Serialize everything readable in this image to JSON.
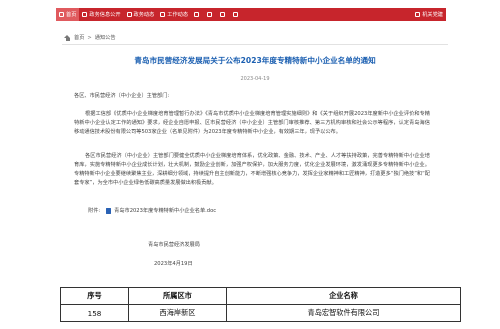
{
  "nav": {
    "items": [
      {
        "label": "首页",
        "icon": "home-icon",
        "active": true
      },
      {
        "label": "政务信息公开",
        "icon": "document-icon"
      },
      {
        "label": "政务动态",
        "icon": "news-icon"
      },
      {
        "label": "工作动态",
        "icon": "briefcase-icon"
      },
      {
        "label": "",
        "icon": "list-icon"
      },
      {
        "label": "",
        "icon": "chat-icon"
      },
      {
        "label": "",
        "icon": "people-icon"
      },
      {
        "label": "",
        "icon": "star-icon"
      },
      {
        "label": "机关党建",
        "icon": "flag-icon"
      }
    ],
    "color": "#c7252c"
  },
  "breadcrumb": {
    "home": "首页",
    "separator": ">",
    "current": "通知公告"
  },
  "article": {
    "title": "青岛市民营经济发展局关于公布2023年度专精特新中小企业名单的通知",
    "date": "2023-04-19",
    "salutation": "各区、市民营经济（中小企业）主管部门:",
    "paragraph1": "根据工信部《优质中小企业梯度培育管理暂行办法》《青岛市优质中小企业梯度培育管理实施细则》和《关于组织开展2023年度新中小企业评价和专精特新中小企业认定工作的通知》要求，经企业自愿申报、区市民营经济（中小企业）主管部门审核推荐、第三方机构审核和社会公示等程序，认定青岛海信移动通信技术股份有限公司等503家企业（名单见附件）为2023年度专精特新中小企业，有效期三年，现予以公布。",
    "paragraph2": "各区市民营经济（中小企业）主管部门要健全优质中小企业梯度培育体系，优化政策、金融、技术、产业、人才等扶持政策，完善专精特新中小企业培育库，实施专精特新中小企业成长计划，壮大机制，鼓励企业创新，加强产权保护，加大服务力度，优化企业发展环境，激发涌现更多专精特新中小企业。专精特新中小企业要继续聚焦主业，深耕细分领域，持续提升自主创新能力，不断增强核心竞争力，发挥企业家精神和工匠精神，打造更多“独门绝技”和“配套专家”，为全市中小企业绿色低碳高质量发展做出积极贡献。",
    "attachment_label": "附件:",
    "attachment_file": "青岛市2023年度专精特新中小企业名单.doc",
    "signer": "青岛市民营经济发展局",
    "sign_date": "2023年4月19日"
  },
  "table": {
    "headers": [
      "序号",
      "所属区市",
      "企业名称"
    ],
    "rows": [
      [
        "158",
        "西海岸新区",
        "青岛宏智软件有限公司"
      ]
    ]
  }
}
